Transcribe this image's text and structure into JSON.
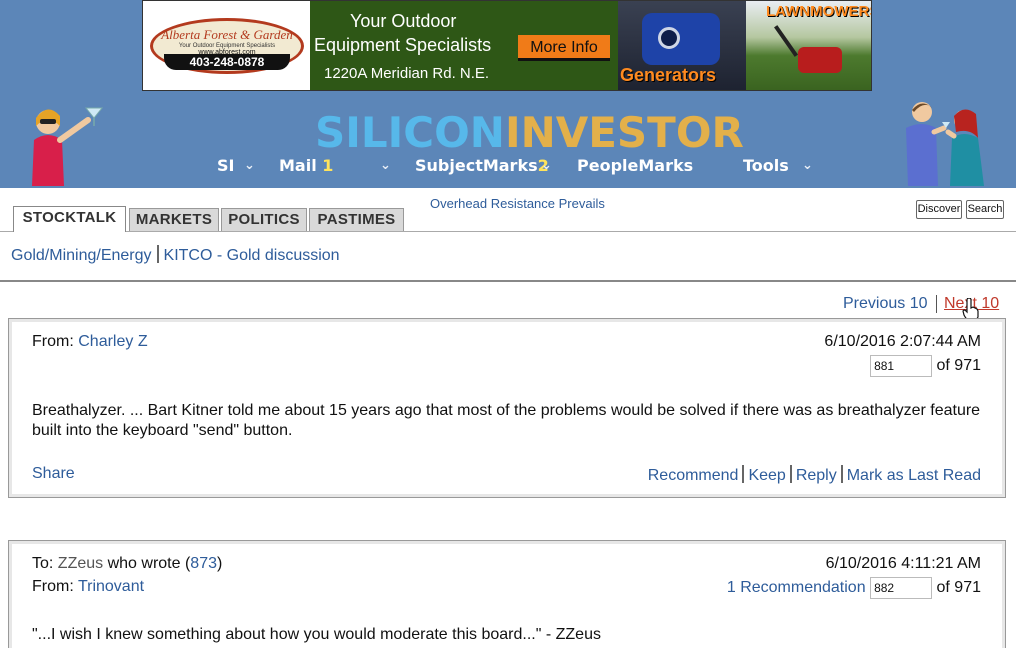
{
  "ad": {
    "logo_name": "Alberta Forest & Garden",
    "logo_tagline": "Your Outdoor Equipment Specialists",
    "logo_web": "www.abforest.com",
    "logo_phone": "403-248-0878",
    "headline_1": "Your Outdoor",
    "headline_2": "Equipment Specialists",
    "address": "1220A Meridian Rd. N.E.",
    "more_info": "More Info",
    "generators": "Generators",
    "lawnmowers": "LAWNMOWERS"
  },
  "site": {
    "logo_part1": "SILICON",
    "logo_part2": "INVESTOR",
    "colors": {
      "header_bg": "#5c86b8",
      "logo_blue": "#57b8ea",
      "logo_gold": "#e3b04a",
      "link": "#2e5c9a"
    }
  },
  "nav": {
    "si": "SI",
    "mail": "Mail",
    "mail_count": "1",
    "subjectmarks": "SubjectMarks",
    "subjectmarks_count": "2",
    "peoplemarks": "PeopleMarks",
    "tools": "Tools",
    "caret": "⌄"
  },
  "tabs": [
    "STOCKTALK",
    "MARKETS",
    "POLITICS",
    "PASTIMES"
  ],
  "thread_title": "Overhead Resistance Prevails",
  "buttons": {
    "discover": "Discover",
    "search": "Search"
  },
  "breadcrumb": {
    "category": "Gold/Mining/Energy",
    "thread": "KITCO - Gold discussion"
  },
  "pager": {
    "previous": "Previous 10",
    "next": "Next 10"
  },
  "messages": [
    {
      "from_label": "From:",
      "from": "Charley Z",
      "date": "6/10/2016 2:07:44 AM",
      "number": "881",
      "of_total": "of 971",
      "body": "Breathalyzer. ... Bart Kitner told me about 15 years ago that most of the problems would be solved if there was as breathalyzer feature built into the keyboard \"send\" button.",
      "share": "Share",
      "actions": [
        "Recommend",
        "Keep",
        "Reply",
        "Mark as Last Read"
      ]
    },
    {
      "to_label": "To:",
      "to": "ZZeus",
      "who_wrote": "who wrote (",
      "reply_to": "873",
      "close_paren": ")",
      "from_label": "From:",
      "from": "Trinovant",
      "date": "6/10/2016 4:11:21 AM",
      "recommendations": "1 Recommendation",
      "number": "882",
      "of_total": "of 971",
      "body": "\"...I wish I knew something about how you would moderate this board...\" - ZZeus"
    }
  ]
}
